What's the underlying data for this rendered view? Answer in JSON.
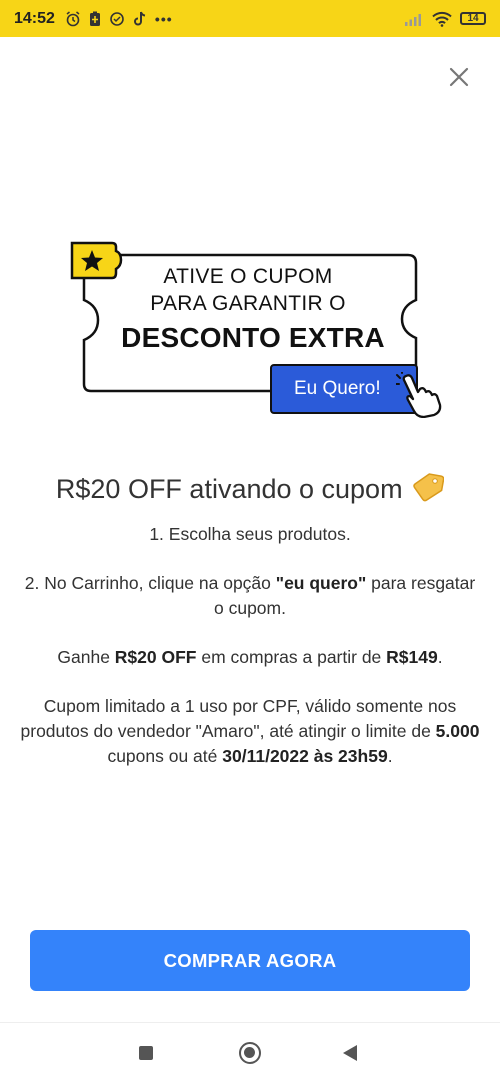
{
  "status_bar": {
    "time": "14:52",
    "icons": [
      "alarm-icon",
      "battery-saver-icon",
      "app-icon",
      "tiktok-icon",
      "more-icon"
    ],
    "more": "•••",
    "battery_level": "14"
  },
  "banner": {
    "line1": "ATIVE O CUPOM",
    "line2": "PARA GARANTIR O",
    "line3": "DESCONTO EXTRA",
    "button_label": "Eu Quero!"
  },
  "offer": {
    "title": "R$20 OFF ativando o cupom",
    "step1": "1. Escolha seus produtos.",
    "step2_pre": "2. No Carrinho, clique na opção ",
    "step2_bold": "\"eu quero\"",
    "step2_post": " para resgatar o cupom.",
    "gain_pre": "Ganhe ",
    "gain_bold1": "R$20 OFF",
    "gain_mid": " em compras a partir de ",
    "gain_bold2": "R$149",
    "gain_post": ".",
    "limit_pre": "Cupom limitado a 1 uso por CPF, válido somente nos produtos do vendedor \"Amaro\", até atingir o limite de ",
    "limit_bold1": "5.000",
    "limit_mid": " cupons ou até ",
    "limit_bold2": "30/11/2022 às 23h59",
    "limit_post": "."
  },
  "cta": {
    "label": "COMPRAR AGORA"
  },
  "colors": {
    "status_bar": "#f7d517",
    "cta": "#3483fa",
    "banner_button": "#2b5bd9",
    "star_badge": "#f7d517"
  }
}
